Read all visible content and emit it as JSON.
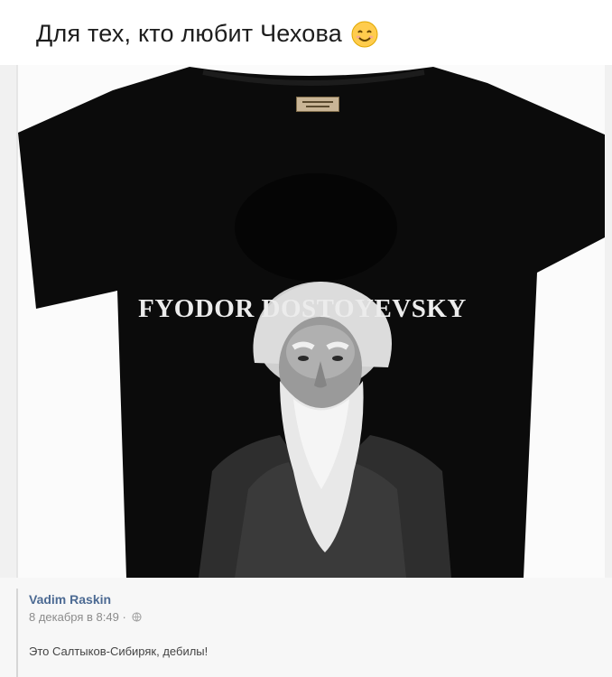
{
  "post": {
    "text": "Для тех, кто любит Чехова",
    "emoji_icon": "smiling-face-icon"
  },
  "image": {
    "shirt_caption": "FYODOR DOSTOYEVSKY",
    "shirt_color": "#0a0a0a"
  },
  "comment": {
    "author": "Vadim Raskin",
    "date": "8 декабря в 8:49 ·",
    "privacy_icon": "globe-icon",
    "text": "Это Салтыков-Сибиряк, дебилы!"
  },
  "colors": {
    "author_link": "#4c6a93",
    "meta": "#8c8c8c"
  }
}
